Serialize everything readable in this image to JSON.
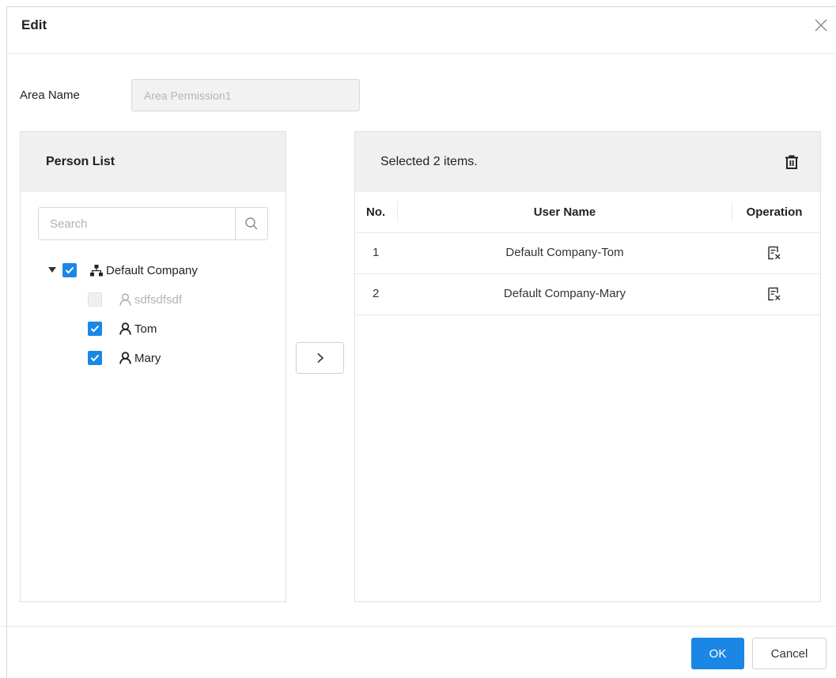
{
  "dialog": {
    "title": "Edit"
  },
  "area": {
    "label": "Area Name",
    "value": "Area Permission1"
  },
  "person_list": {
    "title": "Person List",
    "search_placeholder": "Search",
    "company": {
      "name": "Default Company",
      "checked": true,
      "expanded": true
    },
    "people": [
      {
        "name": "sdfsdfsdf",
        "checked": false,
        "disabled": true
      },
      {
        "name": "Tom",
        "checked": true,
        "disabled": false
      },
      {
        "name": "Mary",
        "checked": true,
        "disabled": false
      }
    ]
  },
  "transfer_button": {
    "label": ">"
  },
  "selected": {
    "summary": "Selected 2 items.",
    "columns": {
      "no": "No.",
      "user_name": "User Name",
      "operation": "Operation"
    },
    "rows": [
      {
        "no": "1",
        "user_name": "Default Company-Tom"
      },
      {
        "no": "2",
        "user_name": "Default Company-Mary"
      }
    ]
  },
  "footer": {
    "ok_label": "OK",
    "cancel_label": "Cancel"
  },
  "colors": {
    "primary": "#1a87e6",
    "panel_header": "#f0f0f0"
  }
}
